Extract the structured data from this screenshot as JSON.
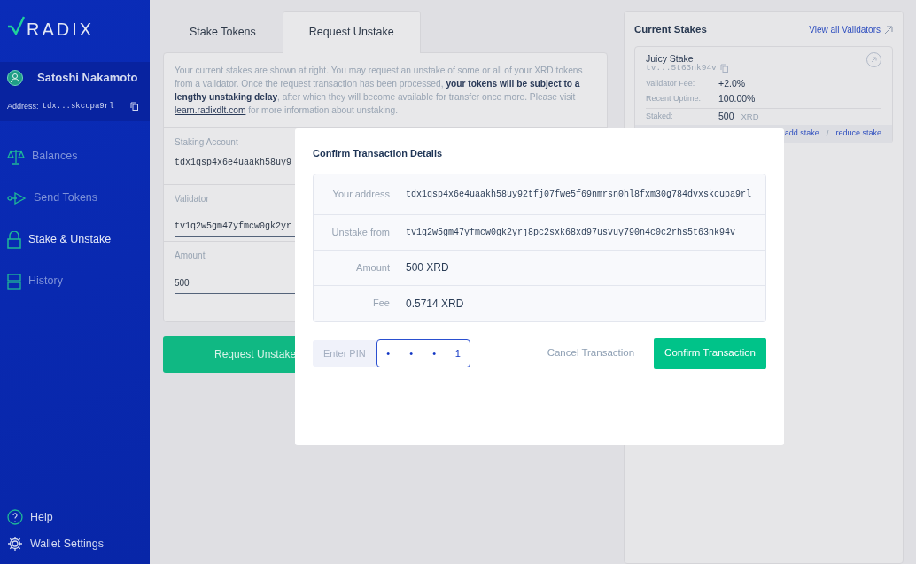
{
  "sidebar": {
    "logo": "RADIX",
    "user": {
      "name": "Satoshi Nakamoto",
      "address_label": "Address:",
      "address": "tdx...skcupa9rl"
    },
    "nav": [
      {
        "label": "Balances",
        "selected": false
      },
      {
        "label": "Send Tokens",
        "selected": false
      },
      {
        "label": "Stake & Unstake",
        "selected": true
      },
      {
        "label": "History",
        "selected": false
      }
    ],
    "footer": [
      {
        "label": "Help"
      },
      {
        "label": "Wallet Settings"
      }
    ]
  },
  "tabs": [
    {
      "label": "Stake Tokens",
      "selected": false
    },
    {
      "label": "Request Unstake",
      "selected": true
    }
  ],
  "notice": {
    "text": "Your current stakes are shown at right. You may request an unstake of some or all of your XRD tokens from a validator. Once the request transaction has been processed, **your tokens will be subject to a lengthy unstaking delay**, after which they will become available for transfer once more. Please visit",
    "link": "learn.radixdlt.com",
    "after": "for more information about unstaking."
  },
  "fields": [
    {
      "label": "Staking Account",
      "value": "tdx1qsp4x6e4uaakh58uy9",
      "kind": "static"
    },
    {
      "label": "Validator",
      "value": "tv1q2w5gm47yfmcw0gk2yr",
      "kind": "input"
    },
    {
      "label": "Amount",
      "value": "500",
      "kind": "input"
    }
  ],
  "submit": "Request Unstake",
  "current_stakes": {
    "title": "Current Stakes",
    "view_all": "View all Validators",
    "stake": {
      "name": "Juicy Stake",
      "address": "tv...5t63nk94v",
      "fee_label": "Validator Fee:",
      "fee": "+2.0%",
      "uptime_label": "Recent Uptime:",
      "uptime": "100.00%",
      "staked_label": "Staked:",
      "staked": "500",
      "unit": "XRD",
      "add": "add stake",
      "separator": "/",
      "reduce": "reduce stake"
    }
  },
  "modal": {
    "title": "Confirm Transaction Details",
    "rows": [
      {
        "label": "Your address",
        "value": "tdx1qsp4x6e4uaakh58uy92tfj07fwe5f69nmrsn0hl8fxm30g784dvxskcupa9rl",
        "kind": "mono"
      },
      {
        "label": "Unstake from",
        "value": "tv1q2w5gm47yfmcw0gk2yrj8pc2sxk68xd97usvuy790n4c0c2rhs5t63nk94v",
        "kind": "mono"
      },
      {
        "label": "Amount",
        "value": "500 XRD",
        "kind": "text"
      },
      {
        "label": "Fee",
        "value": "0.5714 XRD",
        "kind": "text"
      }
    ],
    "pin_label": "Enter PIN",
    "pin": [
      "•",
      "•",
      "•",
      "1"
    ],
    "cancel": "Cancel Transaction",
    "confirm": "Confirm Transaction"
  }
}
